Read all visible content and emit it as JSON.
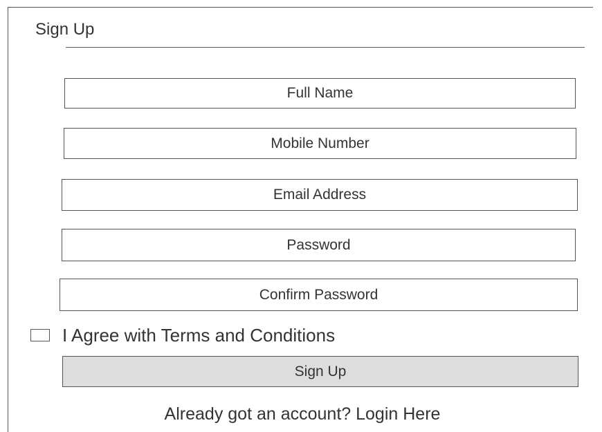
{
  "form": {
    "title": "Sign Up",
    "fields": {
      "full_name": {
        "placeholder": "Full Name",
        "value": ""
      },
      "mobile_number": {
        "placeholder": "Mobile Number",
        "value": ""
      },
      "email_address": {
        "placeholder": "Email Address",
        "value": ""
      },
      "password": {
        "placeholder": "Password",
        "value": ""
      },
      "confirm_password": {
        "placeholder": "Confirm Password",
        "value": ""
      }
    },
    "agree": {
      "label": "I Agree with Terms and Conditions",
      "checked": false
    },
    "submit_label": "Sign Up",
    "login_prompt": "Already got an account? Login Here"
  },
  "colors": {
    "border": "#555555",
    "text": "#333333",
    "button_bg": "#dddddd",
    "background": "#ffffff"
  }
}
